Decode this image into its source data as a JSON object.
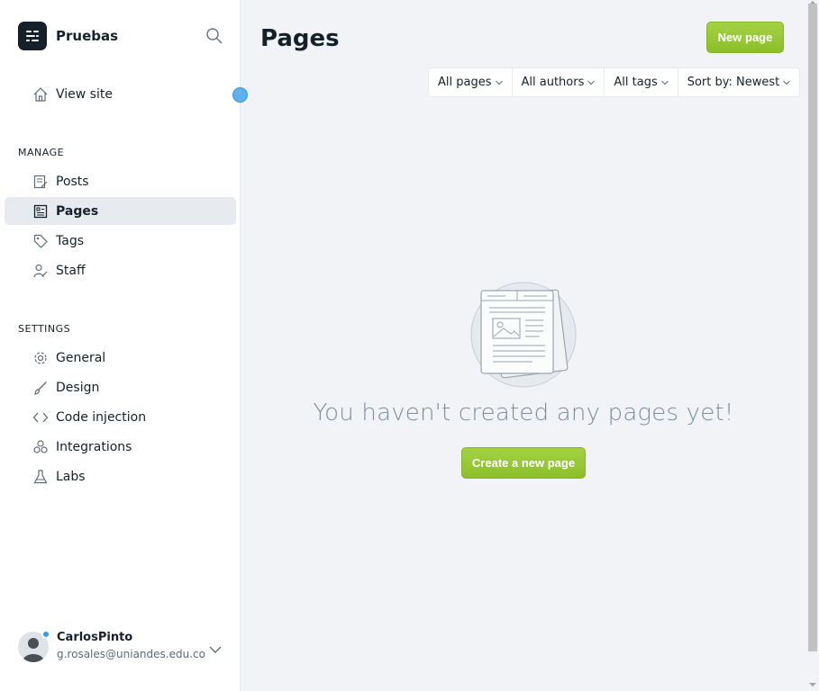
{
  "brand": {
    "name": "Pruebas"
  },
  "sidebar": {
    "view_site": "View site",
    "manage_label": "MANAGE",
    "manage_items": [
      {
        "label": "Posts",
        "icon": "posts-icon"
      },
      {
        "label": "Pages",
        "icon": "pages-icon",
        "active": true
      },
      {
        "label": "Tags",
        "icon": "tag-icon"
      },
      {
        "label": "Staff",
        "icon": "staff-icon"
      }
    ],
    "settings_label": "SETTINGS",
    "settings_items": [
      {
        "label": "General",
        "icon": "gear-icon"
      },
      {
        "label": "Design",
        "icon": "brush-icon"
      },
      {
        "label": "Code injection",
        "icon": "code-icon"
      },
      {
        "label": "Integrations",
        "icon": "integrations-icon"
      },
      {
        "label": "Labs",
        "icon": "flask-icon"
      }
    ]
  },
  "user": {
    "name": "CarlosPinto",
    "email": "g.rosales@uniandes.edu.co"
  },
  "main": {
    "title": "Pages",
    "new_button": "New page",
    "filters": [
      "All pages",
      "All authors",
      "All tags",
      "Sort by: Newest"
    ],
    "empty_text": "You haven't created any pages yet!",
    "create_button": "Create a new page"
  },
  "colors": {
    "accent_green": "#9bc93a",
    "sidebar_active": "#e7ebf0",
    "text_dark": "#15212a"
  }
}
